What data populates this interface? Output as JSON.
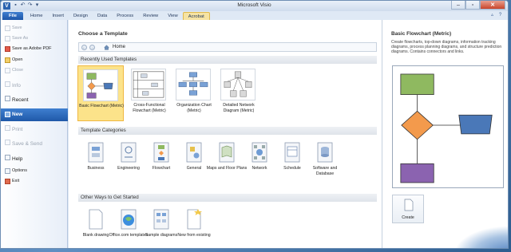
{
  "window": {
    "title": "Microsoft Visio",
    "app_icon": "V"
  },
  "ribbon": {
    "tabs": [
      "File",
      "Home",
      "Insert",
      "Design",
      "Data",
      "Process",
      "Review",
      "View",
      "Acrobat"
    ]
  },
  "leftnav": {
    "items": [
      {
        "label": "Save",
        "disabled": true
      },
      {
        "label": "Save As",
        "disabled": true
      },
      {
        "label": "Save as Adobe PDF",
        "disabled": false
      },
      {
        "label": "Open",
        "disabled": false
      },
      {
        "label": "Close",
        "disabled": true
      },
      {
        "label": "Info",
        "disabled": true,
        "section": true
      },
      {
        "label": "Recent",
        "disabled": false,
        "section": true
      },
      {
        "label": "New",
        "disabled": false,
        "section": true,
        "active": true
      },
      {
        "label": "Print",
        "disabled": true,
        "section": true
      },
      {
        "label": "Save & Send",
        "disabled": true,
        "section": true
      },
      {
        "label": "Help",
        "disabled": false,
        "section": true
      },
      {
        "label": "Options",
        "disabled": false
      },
      {
        "label": "Exit",
        "disabled": false
      }
    ]
  },
  "main": {
    "title": "Choose a Template",
    "nav": {
      "back": "←",
      "forward": "→",
      "home_label": "Home"
    },
    "recent_section": "Recently Used Templates",
    "recent_templates": [
      {
        "label": "Basic Flowchart (Metric)",
        "selected": true
      },
      {
        "label": "Cross-Functional Flowchart (Metric)"
      },
      {
        "label": "Organization Chart (Metric)"
      },
      {
        "label": "Detailed Network Diagram (Metric)"
      }
    ],
    "categories_section": "Template Categories",
    "categories": [
      {
        "label": "Business"
      },
      {
        "label": "Engineering"
      },
      {
        "label": "Flowchart"
      },
      {
        "label": "General"
      },
      {
        "label": "Maps and Floor Plans"
      },
      {
        "label": "Network"
      },
      {
        "label": "Schedule"
      },
      {
        "label": "Software and Database"
      }
    ],
    "other_section": "Other Ways to Get Started",
    "other": [
      {
        "label": "Blank drawing"
      },
      {
        "label": "Office.com templates"
      },
      {
        "label": "Sample diagrams"
      },
      {
        "label": "New from existing"
      }
    ]
  },
  "preview": {
    "title": "Basic Flowchart (Metric)",
    "description": "Create flowcharts, top-down diagrams, information tracking diagrams, process planning diagrams, and structure prediction diagrams. Contains connectors and links.",
    "create_label": "Create",
    "colors": {
      "green": "#8fb960",
      "orange": "#f39a4c",
      "blue": "#4a78b8",
      "purple": "#8b63b0"
    }
  }
}
